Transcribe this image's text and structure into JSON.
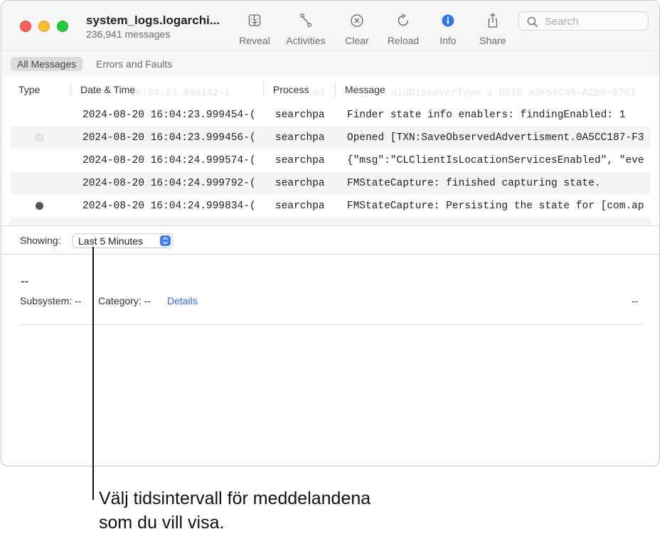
{
  "window": {
    "title": "system_logs.logarchi...",
    "subtitle": "236,941 messages"
  },
  "toolbar": {
    "reveal": "Reveal",
    "activities": "Activities",
    "clear": "Clear",
    "reload": "Reload",
    "info": "Info",
    "share": "Share",
    "search_placeholder": "Search"
  },
  "scopes": [
    "All Messages",
    "Errors and Faults"
  ],
  "columns": {
    "type": "Type",
    "datetime": "Date & Time",
    "process": "Process",
    "message": "Message"
  },
  "ghost_row": {
    "datetime": "16:04:23.999162-(",
    "process": "od",
    "message": "didDiscoverType 1 UUID A6F56C95-A2D8-078I"
  },
  "rows": [
    {
      "type": "",
      "datetime": "2024-08-20 16:04:23.999454-(",
      "process": "searchpa:",
      "message": "Finder state info enablers:   findingEnabled: 1"
    },
    {
      "type": "grey-dot",
      "datetime": "2024-08-20 16:04:23.999456-(",
      "process": "searchpa:",
      "message": "Opened [TXN:SaveObservedAdvertisment.0A5CC187-F3"
    },
    {
      "type": "",
      "datetime": "2024-08-20 16:04:24.999574-(",
      "process": "searchpa:",
      "message": "{\"msg\":\"CLClientIsLocationServicesEnabled\", \"eve"
    },
    {
      "type": "",
      "datetime": "2024-08-20 16:04:24.999792-(",
      "process": "searchpa:",
      "message": "FMStateCapture: finished capturing state."
    },
    {
      "type": "dark-dot",
      "datetime": "2024-08-20 16:04:24.999834-(",
      "process": "searchpa:",
      "message": "FMStateCapture: Persisting the state for [com.ap"
    }
  ],
  "filter": {
    "label": "Showing:",
    "value": "Last 5 Minutes"
  },
  "detail": {
    "title": "--",
    "subsystem": "Subsystem: --",
    "category": "Category: --",
    "details_link": "Details",
    "right": "--"
  },
  "callout": {
    "line1": "Välj tidsintervall för meddelandena",
    "line2": "som du vill visa."
  },
  "colors": {
    "close": "#fe5f57",
    "minimize": "#febc2e",
    "zoom": "#28c840",
    "accent": "#3b7ef6",
    "link": "#2d6ad6"
  }
}
